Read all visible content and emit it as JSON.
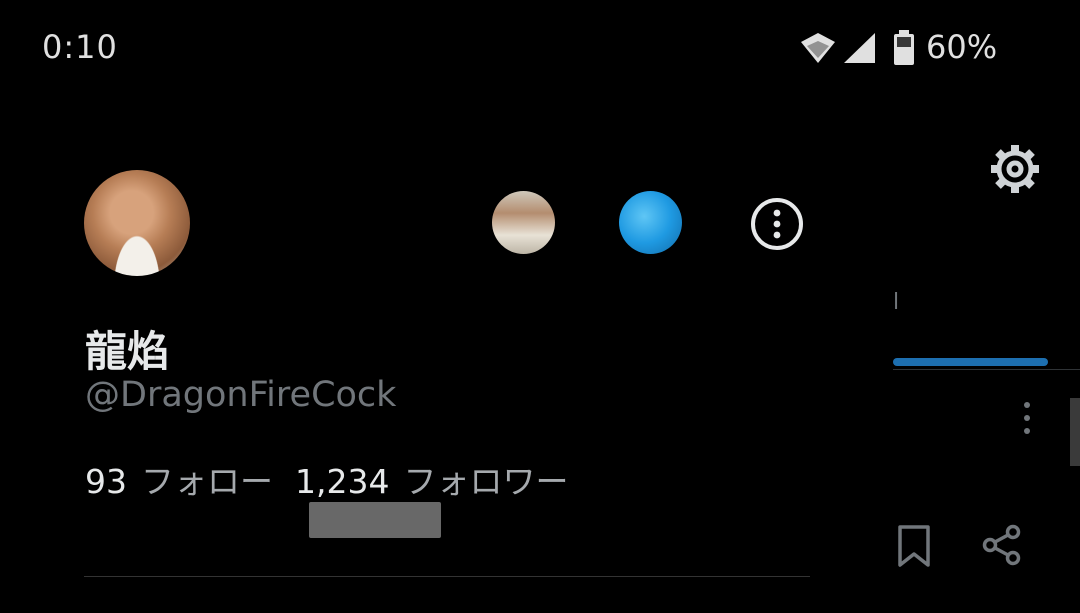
{
  "status_bar": {
    "time": "0:10",
    "battery_percent": "60%",
    "icons": [
      "wifi-icon",
      "cell-signal-icon",
      "battery-icon"
    ]
  },
  "profile": {
    "display_name": "龍焰",
    "handle": "@DragonFireCock",
    "following_count": "93",
    "following_label": "フォロー",
    "followers_count": "1,234",
    "followers_label": "フォロワー"
  },
  "background": {
    "tab_fragment": "l",
    "accent_color": "#1d6fb0",
    "icons": [
      "gear-icon",
      "more-vertical-icon",
      "bookmark-icon",
      "share-icon"
    ]
  },
  "colors": {
    "background": "#000000",
    "primary_text": "#e7e9ea",
    "secondary_text": "#71767b"
  }
}
